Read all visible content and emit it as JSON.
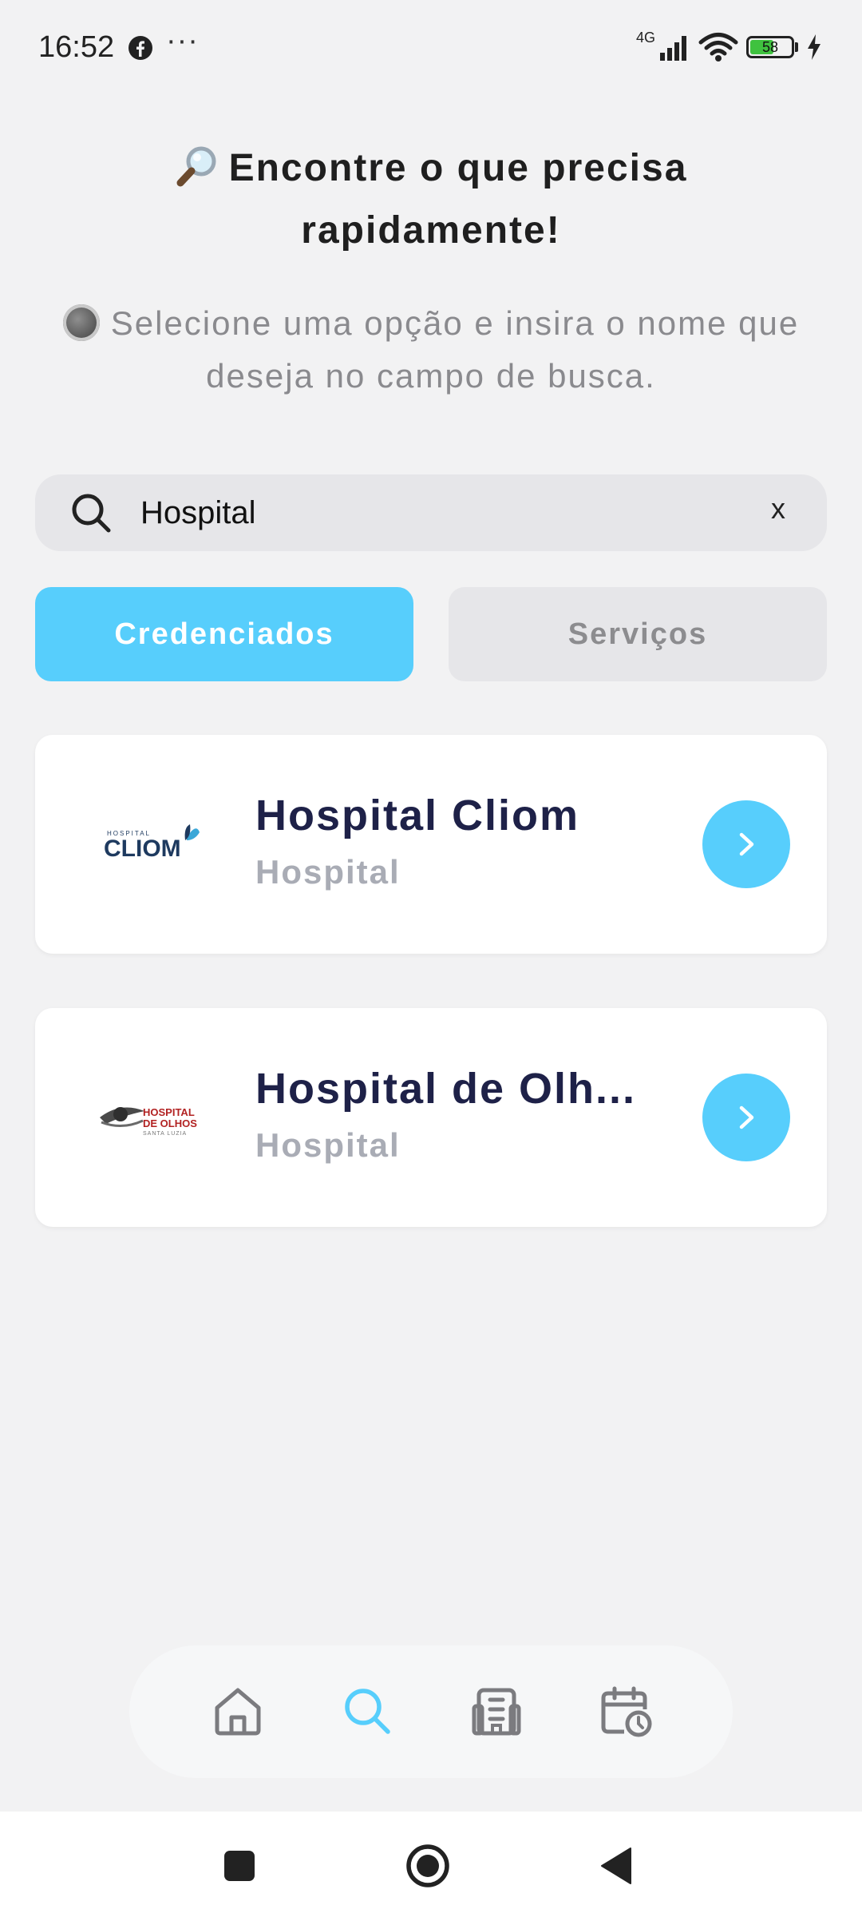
{
  "status_bar": {
    "time": "16:52",
    "network": "4G",
    "battery": "58",
    "battery_level": 0.58,
    "notification_icons": [
      "facebook-icon",
      "more-dots-icon"
    ],
    "dots": "···"
  },
  "header": {
    "title_line1": "Encontre o que precisa",
    "title_line2": "rapidamente!",
    "title_icon": "magnifier-emoji-icon",
    "subtitle_line1": "Selecione uma opção e insira o nome que",
    "subtitle_line2": "deseja no campo de busca."
  },
  "search": {
    "value": "Hospital",
    "clear_label": "x"
  },
  "tabs": [
    {
      "label": "Credenciados",
      "active": true
    },
    {
      "label": "Serviços",
      "active": false
    }
  ],
  "results": [
    {
      "title": "Hospital Cliom",
      "category": "Hospital",
      "logo": {
        "small": "HOSPITAL",
        "main": "CLIOM"
      }
    },
    {
      "title": "Hospital de Olh...",
      "category": "Hospital",
      "logo": {
        "line1": "HOSPITAL",
        "line2": "DE OLHOS",
        "line3": "SANTA LUZIA"
      }
    }
  ],
  "bottom_nav": {
    "items": [
      "home-icon",
      "search-icon",
      "building-icon",
      "calendar-clock-icon"
    ],
    "active": "search-icon"
  },
  "colors": {
    "accent": "#57cefc",
    "background": "#f2f2f3",
    "title_text": "#1e2148",
    "muted_text": "#a9acb5"
  }
}
